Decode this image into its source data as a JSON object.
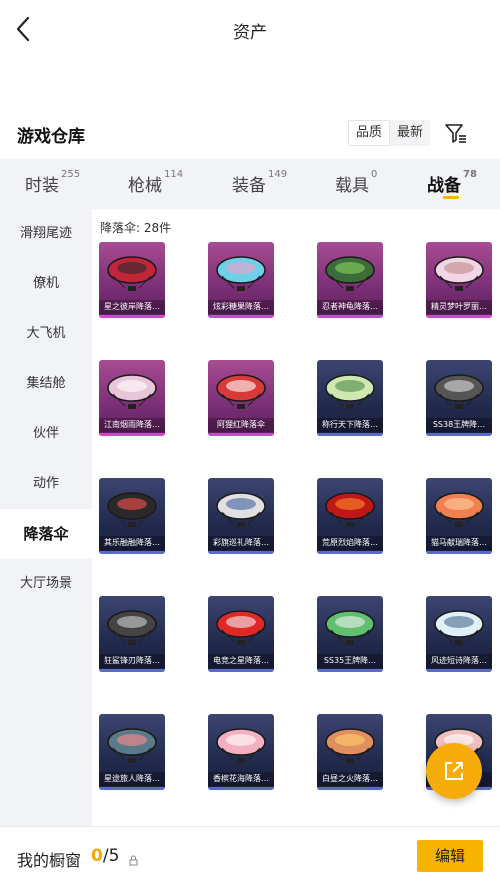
{
  "header": {
    "title": "资产"
  },
  "warehouse": {
    "title": "游戏仓库",
    "sort_options": [
      "品质",
      "最新"
    ]
  },
  "tabs": [
    {
      "label": "时装",
      "count": "255"
    },
    {
      "label": "枪械",
      "count": "114"
    },
    {
      "label": "装备",
      "count": "149"
    },
    {
      "label": "载具",
      "count": "0"
    },
    {
      "label": "战备",
      "count": "78"
    }
  ],
  "sidebar": {
    "items": [
      "滑翔尾迹",
      "僚机",
      "大飞机",
      "集结舱",
      "伙伴",
      "动作",
      "降落伞",
      "大厅场景"
    ]
  },
  "content": {
    "count_text": "降落伞: 28件",
    "items": [
      {
        "name": "星之彼岸降落…",
        "rarity": "purple"
      },
      {
        "name": "炫彩糖果降落…",
        "rarity": "purple"
      },
      {
        "name": "忍者神龟降落…",
        "rarity": "purple"
      },
      {
        "name": "精灵梦叶罗丽…",
        "rarity": "purple"
      },
      {
        "name": "江南烟雨降落…",
        "rarity": "purple"
      },
      {
        "name": "阿狸红降落伞",
        "rarity": "purple"
      },
      {
        "name": "称行天下降落…",
        "rarity": "navy"
      },
      {
        "name": "SS38王牌降…",
        "rarity": "navy"
      },
      {
        "name": "其乐融融降落…",
        "rarity": "navy"
      },
      {
        "name": "彩旗巡礼降落…",
        "rarity": "navy"
      },
      {
        "name": "荒原烈焰降落…",
        "rarity": "navy"
      },
      {
        "name": "猫马献瑞降落…",
        "rarity": "navy"
      },
      {
        "name": "狂鲨锋刃降落…",
        "rarity": "navy"
      },
      {
        "name": "电竞之星降落…",
        "rarity": "navy"
      },
      {
        "name": "SS35王牌降…",
        "rarity": "navy"
      },
      {
        "name": "风迹短诗降落…",
        "rarity": "navy"
      },
      {
        "name": "星途旅人降落…",
        "rarity": "navy"
      },
      {
        "name": "香槟花海降落…",
        "rarity": "navy"
      },
      {
        "name": "白昼之火降落…",
        "rarity": "navy"
      },
      {
        "name": "",
        "rarity": "navy"
      }
    ]
  },
  "bottom": {
    "showcase_label": "我的橱窗",
    "current": "0",
    "total": "/5",
    "edit_label": "编辑"
  },
  "colors": {
    "accent": "#f6b400",
    "purple_rarity": "#7a2f76",
    "navy_rarity": "#222a4d"
  }
}
